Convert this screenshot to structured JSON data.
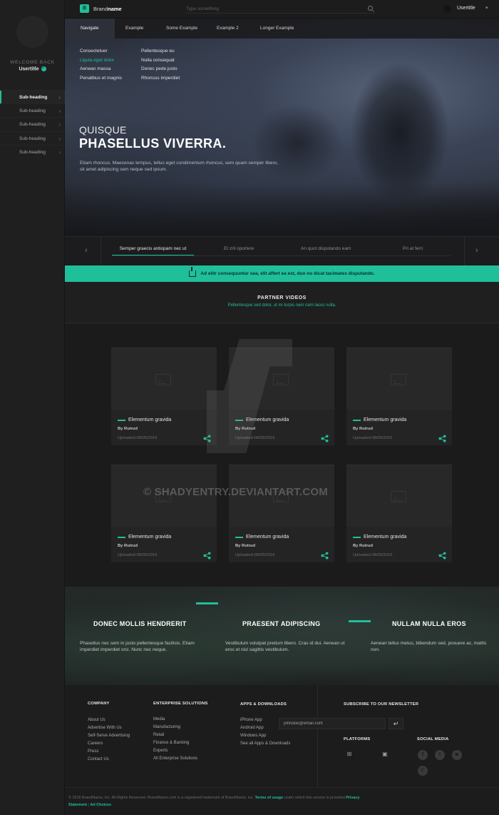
{
  "sidebar": {
    "welcome": "WELCOME BACK",
    "usertitle": "Usertitle",
    "items": [
      {
        "label": "Sub-heading"
      },
      {
        "label": "Sub-heading"
      },
      {
        "label": "Sub-heading"
      },
      {
        "label": "Sub-heading"
      },
      {
        "label": "Sub-heading"
      }
    ]
  },
  "topbar": {
    "brand_prefix": "Brand",
    "brand_bold": "name",
    "search_placeholder": "Type something",
    "user": "Usertitle"
  },
  "nav": {
    "items": [
      "Navigate",
      "Example",
      "Some Example",
      "Example 2",
      "Longer Example"
    ],
    "dropdown_col1": [
      "Consectetuer",
      "Ligula eget dolor",
      "Aenean massa",
      "Penatibus et magnis"
    ],
    "dropdown_col2": [
      "Pellentesque eu",
      "Nulla consequat",
      "Donec pede justo",
      "Rhoncus imperdiet"
    ]
  },
  "hero": {
    "kicker": "QUISQUE",
    "title": "PHASELLUS VIVERRA.",
    "text": "Etiam rhoncus. Maecenas tempus, tellus eget condimentum rhoncus, sem quam semper libero, sit amet adipiscing sem neque sed ipsum."
  },
  "slider_tabs": [
    "Semper graecis antiopam nec ut",
    "Et zril oportere",
    "An quot disputando eam",
    "Pri at ferri"
  ],
  "banner": {
    "text": "Ad elitr consequuntur sea, elit affert ea est, duo no dicat tacimates disputando."
  },
  "partner": {
    "title": "PARTNER VIDEOS",
    "subtitle": "Pellentesque sed dolor, ut mi turpis nam nam lacus nulla."
  },
  "videos": [
    {
      "title": "Elementum gravida",
      "by": "By Rutrud",
      "date": "Uploaded 08/05/2016"
    },
    {
      "title": "Elementum gravida",
      "by": "By Rutrud",
      "date": "Uploaded 08/05/2016"
    },
    {
      "title": "Elementum gravida",
      "by": "By Rutrud",
      "date": "Uploaded 08/05/2016"
    },
    {
      "title": "Elementum gravida",
      "by": "By Rutrud",
      "date": "Uploaded 08/05/2016"
    },
    {
      "title": "Elementum gravida",
      "by": "By Rutrud",
      "date": "Uploaded 08/05/2016"
    },
    {
      "title": "Elementum gravida",
      "by": "By Rutrud",
      "date": "Uploaded 08/05/2016"
    }
  ],
  "watermark": "© SHADYENTRY.DEVIANTART.COM",
  "features": [
    {
      "title": "DONEC MOLLIS HENDRERIT",
      "text": "Phasellus nec sem in justo pellentesque facilisis. Etiam imperdiet imperdiet orci. Nunc nec neque."
    },
    {
      "title": "PRAESENT ADIPISCING",
      "text": "Vestibulum volutpat pretium libero. Cras id dui. Aenean ut eros et nisl sagittis vestibulum."
    },
    {
      "title": "NULLAM NULLA EROS",
      "text": "Aenean tellus metus, bibendum sed, posuere ac, mattis non."
    }
  ],
  "footer": {
    "company": {
      "head": "COMPANY",
      "links": [
        "About Us",
        "Advertise With Us",
        "Self-Serve Advertising",
        "Careers",
        "Press",
        "Contact Us"
      ]
    },
    "enterprise": {
      "head": "ENTERPRISE SOLUTIONS",
      "links": [
        "Media",
        "Manufacturing",
        "Retail",
        "Finance & Banking",
        "Experts",
        "All Enterprise Solutions"
      ]
    },
    "apps": {
      "head": "APPS & DOWNLOADS",
      "links": [
        "iPhone App",
        "Android App",
        "Windows App",
        "See all Apps & Downloads"
      ]
    },
    "newsletter": {
      "head": "SUBSCRIBE TO OUR NEWSLETTER",
      "email_value": "johndoe@email.com"
    },
    "platforms_head": "PLATFORMS",
    "social_head": "SOCIAL MEDIA",
    "legal_1": "© 2016 BrandName, Inc. All Rights Reserved. BrandName.com is a registered trademark of BrandName, inc.",
    "legal_terms": "Terms of usage",
    "legal_2": "under which this service is provided",
    "legal_privacy": "Privacy Statement",
    "legal_sep": "|",
    "legal_ad": "Ad Choices"
  },
  "colors": {
    "accent": "#1fbf9a",
    "background": "#1d1d1e"
  }
}
